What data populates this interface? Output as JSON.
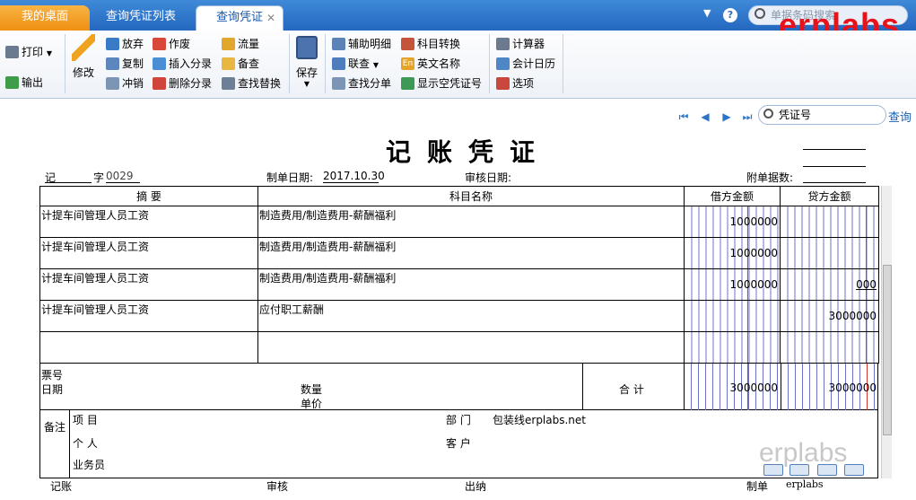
{
  "tabs": {
    "home": "我的桌面",
    "list": "查询凭证列表",
    "active": "查询凭证"
  },
  "global_search": {
    "placeholder": "单据条码搜索"
  },
  "brand": "erplabs",
  "toolbar": {
    "print": "打印",
    "export": "输出",
    "edit": "修改",
    "abandon": "放弃",
    "copy": "复制",
    "reverse": "冲销",
    "void": "作废",
    "insert_entry": "插入分录",
    "delete_entry": "删除分录",
    "flow": "流量",
    "note": "备查",
    "find_replace": "查找替换",
    "save": "保存",
    "aux_detail": "辅助明细",
    "linked_query": "联查",
    "find_entry": "查找分单",
    "account_convert": "科目转换",
    "english_name": "英文名称",
    "show_empty_no": "显示空凭证号",
    "calculator": "计算器",
    "calendar": "会计日历",
    "options": "选项"
  },
  "voucher_search": {
    "placeholder": "凭证号",
    "button": "查询"
  },
  "voucher": {
    "title": "记账凭证",
    "type": "记",
    "zi": "字",
    "number": "0029",
    "date_label": "制单日期:",
    "date": "2017.10.30",
    "audit_label": "审核日期:",
    "attach_label": "附单据数:",
    "headers": {
      "summary": "摘 要",
      "account": "科目名称",
      "debit": "借方金额",
      "credit": "贷方金额"
    },
    "rows": [
      {
        "summary": "计提车间管理人员工资",
        "account": "制造费用/制造费用-薪酬福利",
        "debit": "1000000",
        "credit": ""
      },
      {
        "summary": "计提车间管理人员工资",
        "account": "制造费用/制造费用-薪酬福利",
        "debit": "1000000",
        "credit": ""
      },
      {
        "summary": "计提车间管理人员工资",
        "account": "制造费用/制造费用-薪酬福利",
        "debit": "1000000",
        "credit": "000"
      },
      {
        "summary": "计提车间管理人员工资",
        "account": "应付职工薪酬",
        "debit": "",
        "credit": "3000000"
      },
      {
        "summary": "",
        "account": "",
        "debit": "",
        "credit": ""
      }
    ],
    "footer": {
      "ticket_no": "票号",
      "date": "日期",
      "qty": "数量",
      "price": "单价",
      "total": "合 计",
      "debit_total": "3000000",
      "credit_total": "3000000"
    },
    "remark": {
      "label": "备注",
      "project": "项  目",
      "dept": "部  门",
      "dept_value": "包装线erplabs.net",
      "person": "个  人",
      "customer": "客  户",
      "salesman": "业务员"
    },
    "sign": {
      "bookkeeping": "记账",
      "audit": "审核",
      "cashier": "出纳",
      "maker": "制单",
      "maker_name": "erplabs"
    }
  },
  "watermark": "erplabs"
}
